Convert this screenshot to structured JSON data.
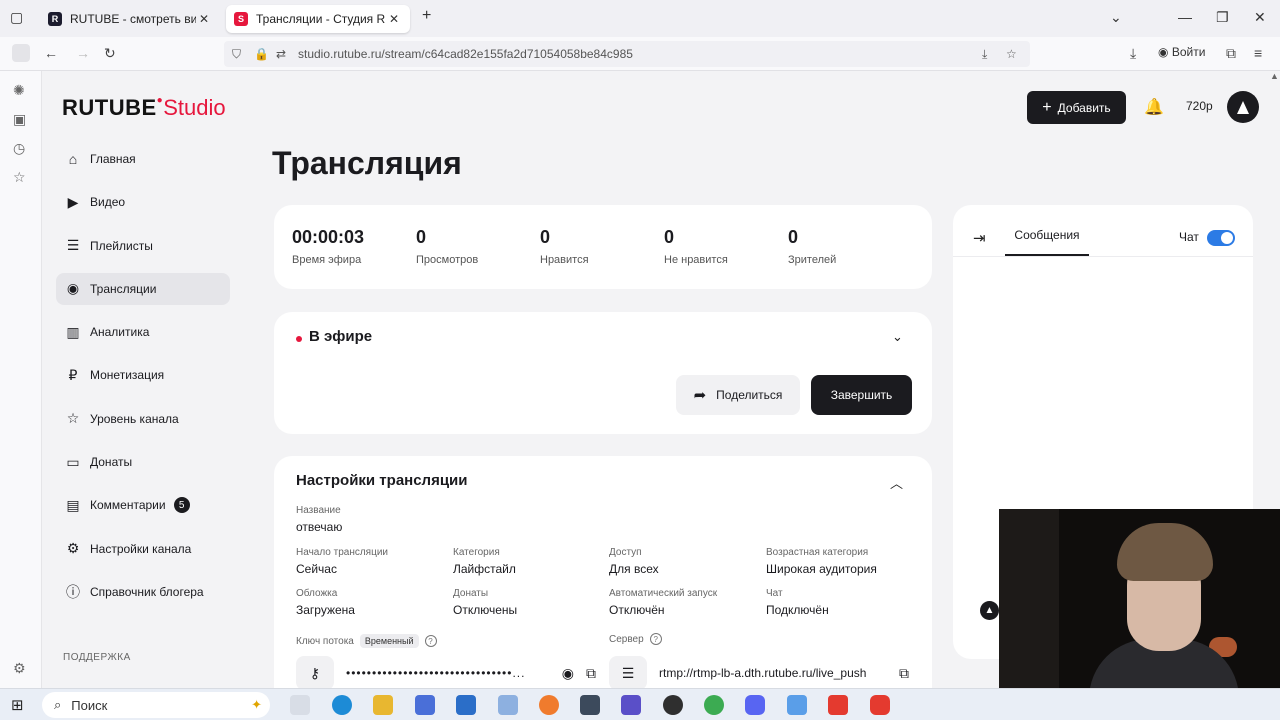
{
  "browser": {
    "tabs": [
      {
        "title": "RUTUBE - смотреть видео онл",
        "active": false
      },
      {
        "title": "Трансляции - Студия RUTUBE",
        "active": true
      }
    ],
    "url": "studio.rutube.ru/stream/c64cad82e155fa2d71054058be84c985",
    "sign_in": "Войти"
  },
  "studio": {
    "logo_brand": "RUTUBE",
    "logo_suffix": "Studio",
    "add_button": "Добавить",
    "quality": "720p",
    "menu": [
      {
        "label": "Главная",
        "icon": "home-icon"
      },
      {
        "label": "Видео",
        "icon": "video-icon"
      },
      {
        "label": "Плейлисты",
        "icon": "playlist-icon"
      },
      {
        "label": "Трансляции",
        "icon": "broadcast-icon",
        "active": true
      },
      {
        "label": "Аналитика",
        "icon": "analytics-icon"
      },
      {
        "label": "Монетизация",
        "icon": "ruble-icon"
      },
      {
        "label": "Уровень канала",
        "icon": "star-icon"
      },
      {
        "label": "Донаты",
        "icon": "wallet-icon"
      },
      {
        "label": "Комментарии",
        "icon": "comment-icon",
        "count": "5"
      },
      {
        "label": "Настройки канала",
        "icon": "gear-icon"
      },
      {
        "label": "Справочник блогера",
        "icon": "info-icon"
      }
    ],
    "support_label": "ПОДДЕРЖКА"
  },
  "page": {
    "title": "Трансляция",
    "stats": [
      {
        "value": "00:00:03",
        "label": "Время эфира"
      },
      {
        "value": "0",
        "label": "Просмотров"
      },
      {
        "value": "0",
        "label": "Нравится"
      },
      {
        "value": "0",
        "label": "Не нравится"
      },
      {
        "value": "0",
        "label": "Зрителей"
      }
    ],
    "live": {
      "status": "В эфире",
      "share": "Поделиться",
      "finish": "Завершить"
    },
    "settings": {
      "header": "Настройки трансляции",
      "name_key": "Название",
      "name_value": "отвечаю",
      "fields": [
        {
          "k": "Начало трансляции",
          "v": "Сейчас"
        },
        {
          "k": "Категория",
          "v": "Лайфстайл"
        },
        {
          "k": "Доступ",
          "v": "Для всех"
        },
        {
          "k": "Возрастная категория",
          "v": "Широкая аудитория"
        },
        {
          "k": "Обложка",
          "v": "Загружена"
        },
        {
          "k": "Донаты",
          "v": "Отключены"
        },
        {
          "k": "Автоматический запуск",
          "v": "Отключён"
        },
        {
          "k": "Чат",
          "v": "Подключён"
        }
      ],
      "stream_key_label": "Ключ потока",
      "stream_key_badge": "Временный",
      "stream_key_value": "••••••••••••••••••••••••••••••••...",
      "server_label": "Сервер",
      "server_value": "rtmp://rtmp-lb-a.dth.rutube.ru/live_push"
    },
    "chat": {
      "tab": "Сообщения",
      "toggle_label": "Чат",
      "toggle_on": true
    }
  },
  "taskbar": {
    "search": "Поиск"
  },
  "colors": {
    "accent": "#e6173d",
    "dark": "#1b1b1f",
    "toggle": "#2c7be5"
  }
}
